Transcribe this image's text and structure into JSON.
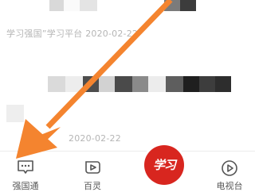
{
  "feed": {
    "items": [
      {
        "meta": "学习强国”学习平台  2020-02-22"
      },
      {
        "meta": "2020-02-22"
      }
    ]
  },
  "tabbar": {
    "tabs": [
      {
        "label": "强国通",
        "icon": "chat-bubble-icon"
      },
      {
        "label": "百灵",
        "icon": "play-square-icon"
      },
      {
        "label": "",
        "icon": "xuexi-logo-icon"
      },
      {
        "label": "电视台",
        "icon": "play-circle-icon"
      }
    ],
    "center_logo_text": "学习"
  },
  "annotation": {
    "arrow_color": "#f4842f",
    "icon": "orange-arrow-icon"
  }
}
